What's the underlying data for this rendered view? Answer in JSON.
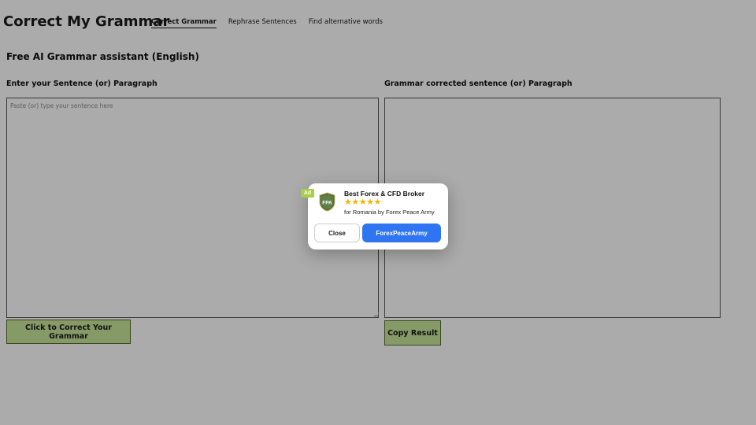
{
  "header": {
    "brand": "Correct My Grammar",
    "nav": [
      {
        "label": "Correct Grammar",
        "active": true
      },
      {
        "label": "Rephrase Sentences",
        "active": false
      },
      {
        "label": "Find alternative words",
        "active": false
      }
    ]
  },
  "main": {
    "title": "Free AI Grammar assistant (English)",
    "input_label": "Enter your Sentence (or) Paragraph",
    "input_placeholder": "Paste (or) type your sentence here",
    "input_value": "",
    "output_label": "Grammar corrected sentence (or) Paragraph",
    "output_value": "",
    "correct_button": "Click to Correct Your Grammar",
    "copy_button": "Copy Result"
  },
  "ad": {
    "badge": "Ad",
    "logo_text": "FPA",
    "title": "Best Forex & CFD Broker",
    "stars": "★★★★★",
    "subtitle": "for Romania by Forex Peace Army",
    "close_label": "Close",
    "cta_label": "ForexPeaceArmy"
  },
  "colors": {
    "button_bg": "#c8e69a",
    "button_border": "#556b2f",
    "ad_badge": "#a8cf45",
    "ad_cta": "#2f74f0",
    "stars": "#f5b400",
    "overlay": "rgba(0,0,0,0.33)"
  }
}
